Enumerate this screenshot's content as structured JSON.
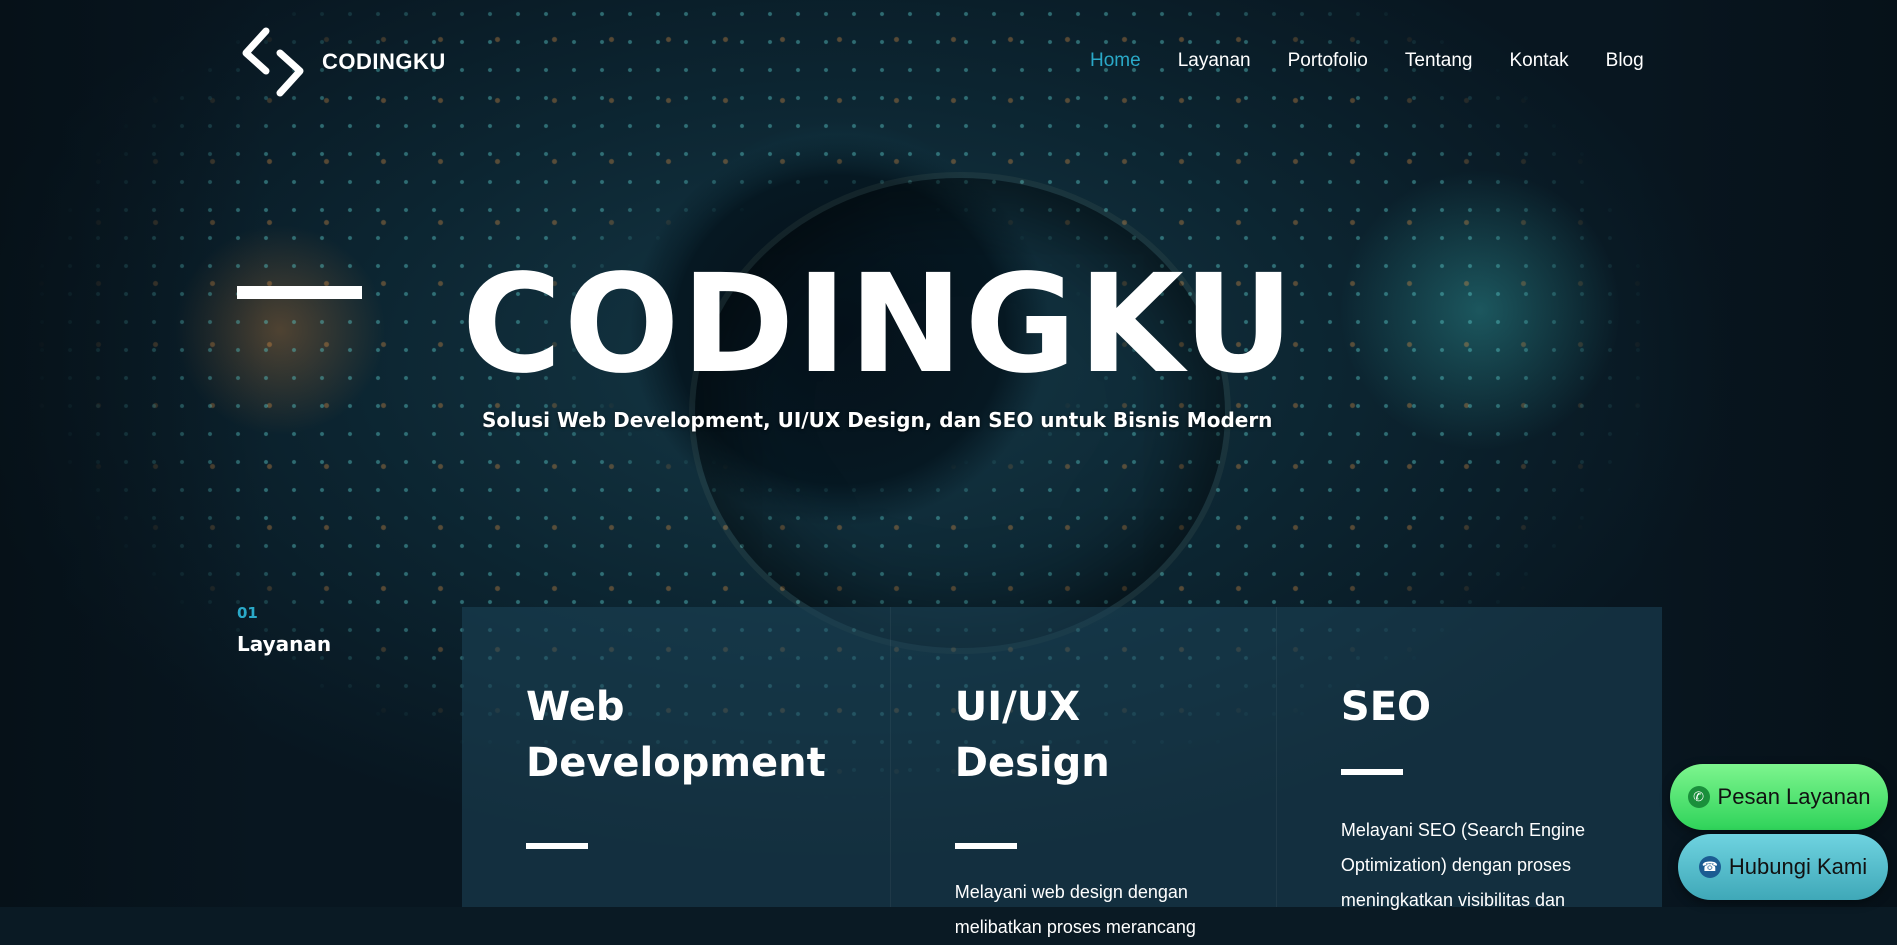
{
  "brand": {
    "name": "CODINGKU"
  },
  "nav": {
    "items": [
      {
        "label": "Home",
        "active": true
      },
      {
        "label": "Layanan",
        "active": false
      },
      {
        "label": "Portofolio",
        "active": false
      },
      {
        "label": "Tentang",
        "active": false
      },
      {
        "label": "Kontak",
        "active": false
      },
      {
        "label": "Blog",
        "active": false
      }
    ]
  },
  "hero": {
    "title": "CODINGKU",
    "subtitle": "Solusi Web Development, UI/UX Design, dan SEO untuk Bisnis Modern"
  },
  "section": {
    "number": "01",
    "label": "Layanan"
  },
  "services": [
    {
      "title": "Web Development",
      "description": ""
    },
    {
      "title": "UI/UX Design",
      "description": "Melayani web design dengan melibatkan proses merancang"
    },
    {
      "title": "SEO",
      "description": "Melayani SEO (Search Engine Optimization) dengan proses meningkatkan visibilitas dan"
    }
  ],
  "floating_buttons": {
    "order": "Pesan Layanan",
    "contact": "Hubungi Kami"
  },
  "colors": {
    "accent": "#2aa9c8",
    "whatsapp_button": "#2fd35a",
    "contact_button": "#3fa8b8"
  },
  "icons": {
    "logo": "code-brackets-icon",
    "order": "whatsapp-icon",
    "contact": "phone-icon"
  }
}
